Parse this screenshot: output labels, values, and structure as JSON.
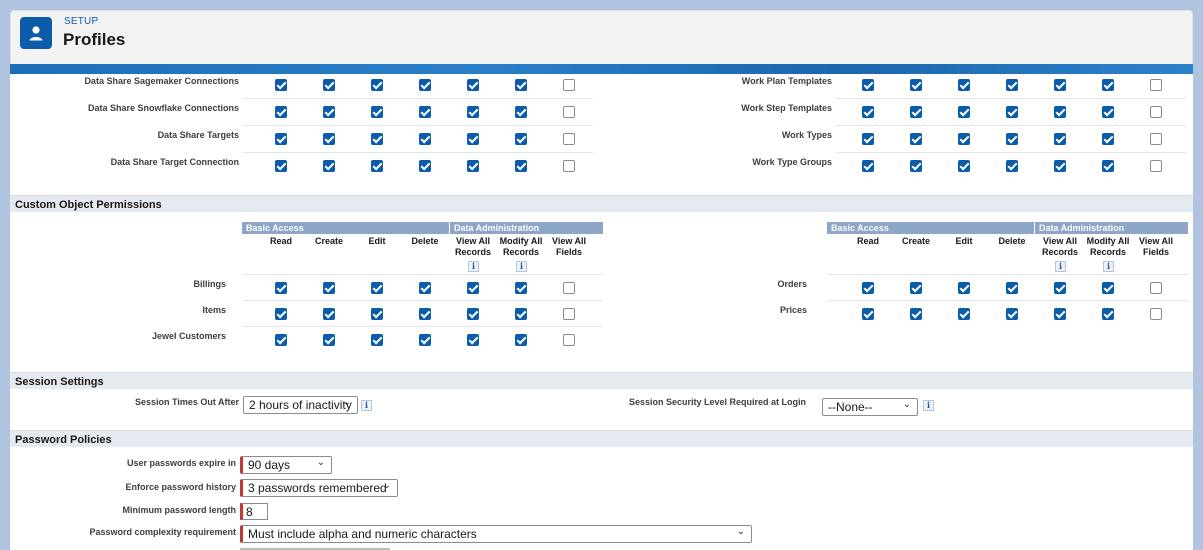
{
  "header": {
    "kicker": "SETUP",
    "title": "Profiles",
    "icon": "user-icon"
  },
  "top_left_rows": [
    {
      "label": "Data Share Sagemaker Connections",
      "checks": [
        true,
        true,
        true,
        true,
        true,
        true,
        false
      ]
    },
    {
      "label": "Data Share Snowflake Connections",
      "checks": [
        true,
        true,
        true,
        true,
        true,
        true,
        false
      ]
    },
    {
      "label": "Data Share Targets",
      "checks": [
        true,
        true,
        true,
        true,
        true,
        true,
        false
      ]
    },
    {
      "label": "Data Share Target Connection",
      "checks": [
        true,
        true,
        true,
        true,
        true,
        true,
        false
      ]
    }
  ],
  "top_right_rows": [
    {
      "label": "Work Plan Templates",
      "checks": [
        true,
        true,
        true,
        true,
        true,
        true,
        false
      ]
    },
    {
      "label": "Work Step Templates",
      "checks": [
        true,
        true,
        true,
        true,
        true,
        true,
        false
      ]
    },
    {
      "label": "Work Types",
      "checks": [
        true,
        true,
        true,
        true,
        true,
        true,
        false
      ]
    },
    {
      "label": "Work Type Groups",
      "checks": [
        true,
        true,
        true,
        true,
        true,
        true,
        false
      ]
    }
  ],
  "custom_object": {
    "title": "Custom Object Permissions",
    "groups": {
      "basic": "Basic Access",
      "admin": "Data Administration"
    },
    "columns": [
      "Read",
      "Create",
      "Edit",
      "Delete",
      "View All Records",
      "Modify All Records",
      "View All Fields"
    ],
    "info_glyph": "i",
    "left_rows": [
      {
        "label": "Billings",
        "checks": [
          true,
          true,
          true,
          true,
          true,
          true,
          false
        ]
      },
      {
        "label": "Items",
        "checks": [
          true,
          true,
          true,
          true,
          true,
          true,
          false
        ]
      },
      {
        "label": "Jewel Customers",
        "checks": [
          true,
          true,
          true,
          true,
          true,
          true,
          false
        ]
      }
    ],
    "right_rows": [
      {
        "label": "Orders",
        "checks": [
          true,
          true,
          true,
          true,
          true,
          true,
          false
        ]
      },
      {
        "label": "Prices",
        "checks": [
          true,
          true,
          true,
          true,
          true,
          true,
          false
        ]
      }
    ]
  },
  "session": {
    "title": "Session Settings",
    "timeout_label": "Session Times Out After",
    "timeout_value": "2 hours of inactivity",
    "security_label": "Session Security Level Required at Login",
    "security_value": "--None--"
  },
  "password": {
    "title": "Password Policies",
    "expire_label": "User passwords expire in",
    "expire_value": "90 days",
    "history_label": "Enforce password history",
    "history_value": "3 passwords remembered",
    "minlen_label": "Minimum password length",
    "minlen_value": "8",
    "complexity_label": "Password complexity requirement",
    "complexity_value": "Must include alpha and numeric characters"
  },
  "colors": {
    "brand": "#0b5cab",
    "section_bg": "#e5e9f0",
    "group_header": "#8da5c6",
    "required": "#c23934"
  }
}
